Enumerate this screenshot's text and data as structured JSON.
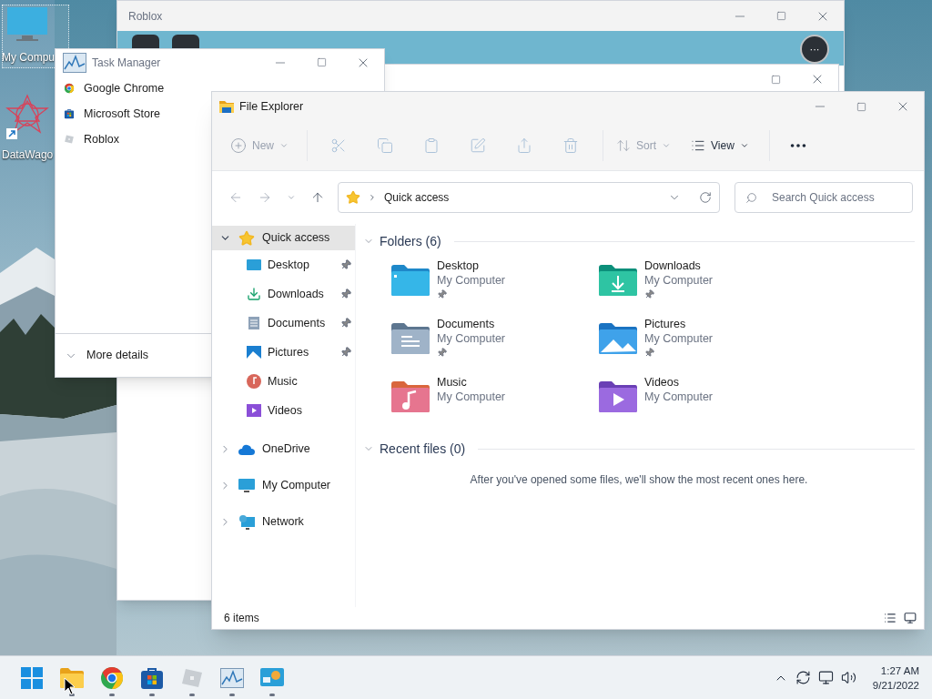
{
  "desktop": {
    "icons": [
      {
        "label": "My Compu",
        "selected": true
      },
      {
        "label": "DataWago",
        "selected": false
      }
    ]
  },
  "roblox_window": {
    "title": "Roblox",
    "more_button": "···"
  },
  "task_manager": {
    "title": "Task Manager",
    "apps": [
      {
        "name": "Google Chrome"
      },
      {
        "name": "Microsoft Store"
      },
      {
        "name": "Roblox"
      }
    ],
    "more_details": "More details"
  },
  "file_explorer": {
    "title": "File Explorer",
    "toolbar": {
      "new": {
        "label": "New",
        "disabled": true
      },
      "actions": [
        {
          "disabled": true
        },
        {
          "disabled": true
        },
        {
          "disabled": true
        },
        {
          "disabled": true
        },
        {
          "disabled": true
        },
        {
          "disabled": true
        }
      ],
      "sort": {
        "label": "Sort",
        "disabled": true
      },
      "view": {
        "label": "View",
        "disabled": false
      }
    },
    "address": "Quick access",
    "search": {
      "placeholder": "Search Quick access"
    },
    "nav": [
      {
        "label": "Quick access",
        "selected": true,
        "expanded": true,
        "children": [
          {
            "label": "Desktop",
            "pinned": true
          },
          {
            "label": "Downloads",
            "pinned": true
          },
          {
            "label": "Documents",
            "pinned": true
          },
          {
            "label": "Pictures",
            "pinned": true
          },
          {
            "label": "Music",
            "pinned": false
          },
          {
            "label": "Videos",
            "pinned": false
          }
        ]
      },
      {
        "label": "OneDrive",
        "selected": false,
        "expanded": false
      },
      {
        "label": "My Computer",
        "selected": false,
        "expanded": false
      },
      {
        "label": "Network",
        "selected": false,
        "expanded": false
      }
    ],
    "folders_heading": "Folders (6)",
    "folders": [
      {
        "name": "Desktop",
        "location": "My Computer",
        "pinned": true
      },
      {
        "name": "Downloads",
        "location": "My Computer",
        "pinned": true
      },
      {
        "name": "Documents",
        "location": "My Computer",
        "pinned": true
      },
      {
        "name": "Pictures",
        "location": "My Computer",
        "pinned": true
      },
      {
        "name": "Music",
        "location": "My Computer",
        "pinned": false
      },
      {
        "name": "Videos",
        "location": "My Computer",
        "pinned": false
      }
    ],
    "recent_heading": "Recent files (0)",
    "recent_empty": "After you've opened some files, we'll show the most recent ones here.",
    "status": "6 items"
  },
  "taskbar": {
    "apps": [
      {
        "running": false
      },
      {
        "running": true
      },
      {
        "running": true
      },
      {
        "running": true
      },
      {
        "running": true
      },
      {
        "running": true
      },
      {
        "running": true
      }
    ],
    "time": "1:27 AM",
    "date": "9/21/2022"
  }
}
